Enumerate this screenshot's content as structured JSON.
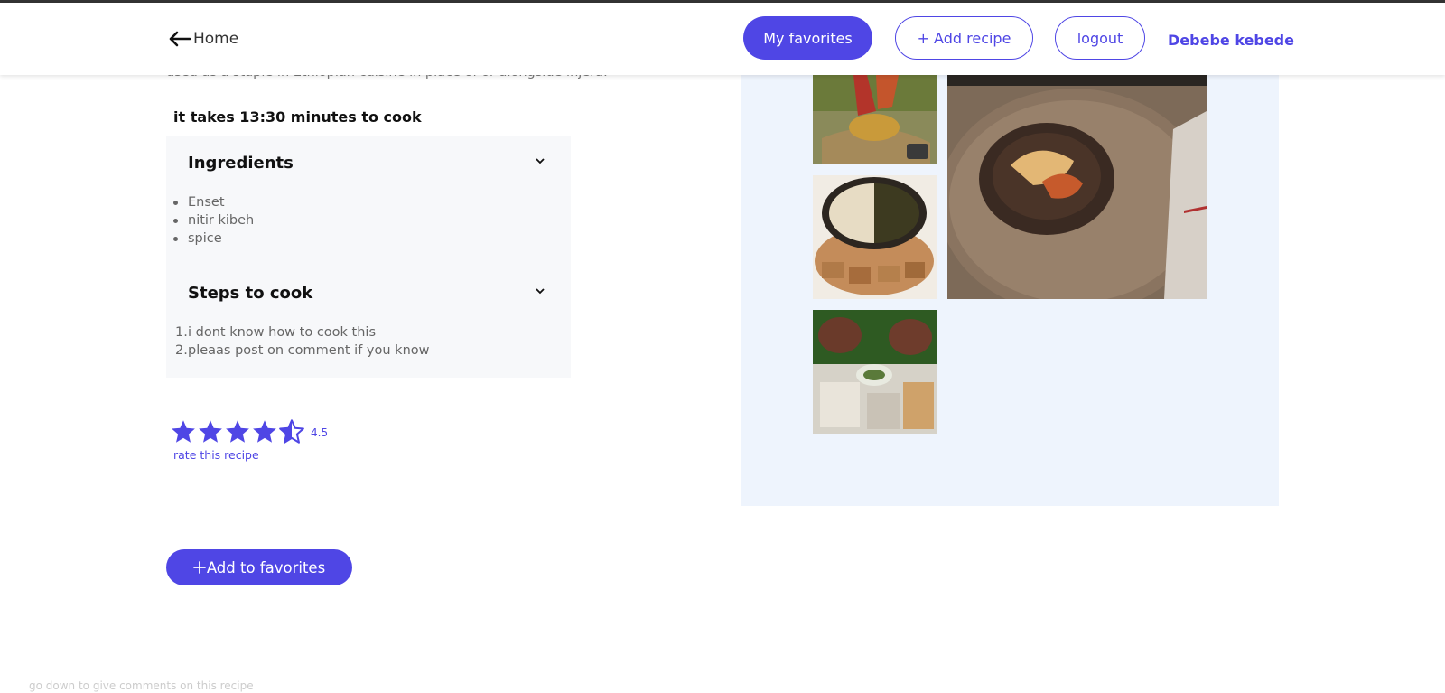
{
  "nav": {
    "home_label": "Home",
    "favorites_label": "My favorites",
    "add_recipe_label": "+ Add recipe",
    "logout_label": "logout",
    "user_name": "Debebe kebede"
  },
  "recipe": {
    "description_tail": "used as a staple in Ethiopian cuisine in place of or alongside injera.",
    "cook_time_text": "it takes 13:30 minutes to cook",
    "ingredients_title": "Ingredients",
    "ingredients": [
      "Enset",
      "nitir kibeh",
      "spice"
    ],
    "steps_title": "Steps to cook",
    "steps": [
      "i dont know how to cook this",
      "pleaas post on comment if you know"
    ],
    "rating": 4.5,
    "rating_label": "4.5",
    "rate_link": "rate this recipe",
    "add_favorites_label": "Add to favorites",
    "comments_hint": "go down to give comments on this recipe"
  },
  "colors": {
    "accent": "#4f46e5",
    "gallery_bg": "#eef4fd",
    "panel_bg": "#f7f8fa"
  },
  "icons": [
    "arrow-left-icon",
    "chevron-down-icon",
    "star-icon",
    "plus-icon"
  ]
}
